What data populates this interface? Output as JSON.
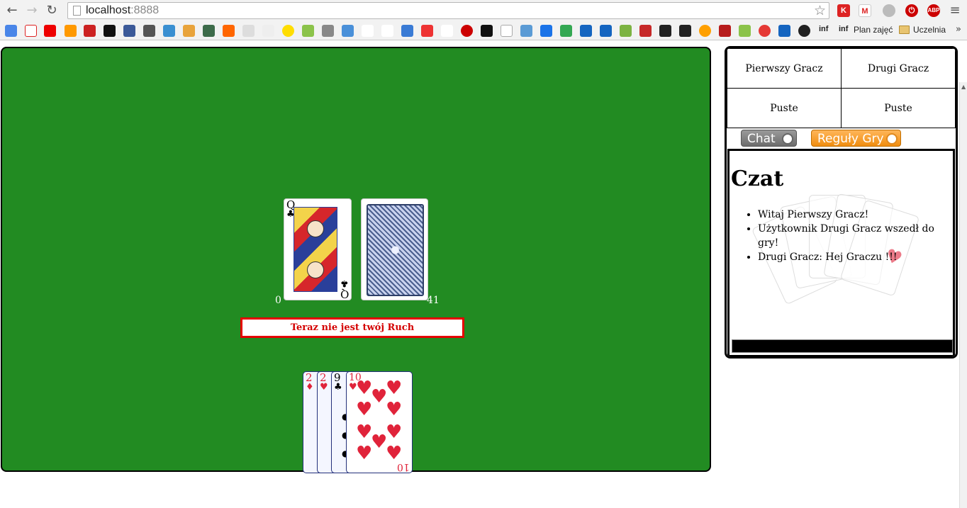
{
  "browser": {
    "url_host": "localhost",
    "url_port": ":8888",
    "bookmarks": {
      "plan_label": "Plan zajęć",
      "folder_label": "Uczelnia",
      "inf_label": "inf"
    },
    "extensions": {
      "abp_label": "ABP"
    }
  },
  "game": {
    "table_card": {
      "rank": "Q",
      "suit": "♣"
    },
    "my_count": "0",
    "deck_count": "41",
    "status_message": "Teraz nie jest twój Ruch",
    "hand": [
      {
        "rank": "2",
        "suit": "♦",
        "color": "#e0233a"
      },
      {
        "rank": "2",
        "suit": "♥",
        "color": "#e0233a"
      },
      {
        "rank": "9",
        "suit": "♣",
        "color": "#000000"
      },
      {
        "rank": "10",
        "suit": "♥",
        "color": "#e0233a"
      }
    ]
  },
  "players": {
    "player1": "Pierwszy Gracz",
    "player2": "Drugi Gracz",
    "slot1": "Puste",
    "slot2": "Puste"
  },
  "tabs": {
    "chat": "Chat",
    "rules": "Reguły Gry"
  },
  "chat": {
    "title": "Czat",
    "messages": [
      "Witaj Pierwszy Gracz!",
      "Użytkownik Drugi Gracz wszedł do gry!",
      "Drugi Gracz: Hej Graczu !!!"
    ],
    "input_value": ""
  },
  "colors": {
    "felt": "#228b22",
    "status_border": "#e50000",
    "status_text": "#d40000",
    "rules_tab": "#f08d10",
    "chat_tab": "#6d6d6d"
  }
}
